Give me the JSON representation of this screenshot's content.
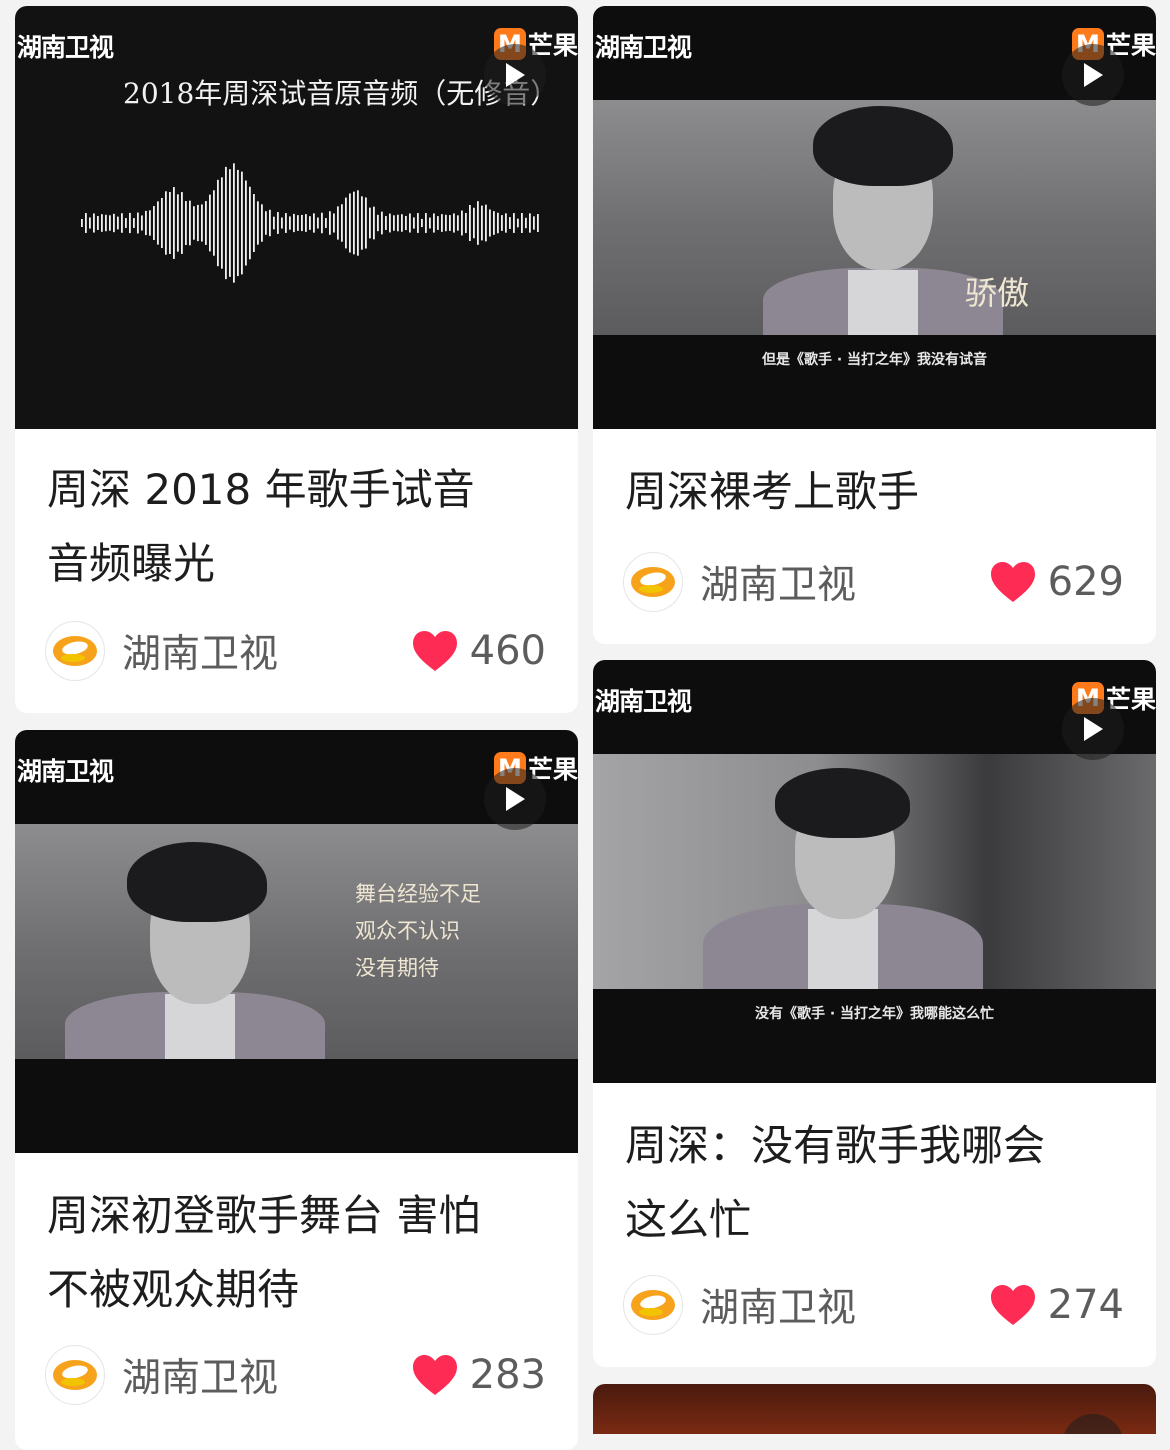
{
  "watermarks": {
    "left": "湖南卫视",
    "right_logo": "M",
    "right_text": "芒果"
  },
  "cards": [
    {
      "title_line1": "周深 2018 年歌手试音",
      "title_line2": "音频曝光",
      "thumb_headline": "2018年周深试音原音频（无修音）",
      "author": "湖南卫视",
      "likes": "460"
    },
    {
      "title_line1": "周深裸考上歌手",
      "thumb_side": "骄傲",
      "thumb_subtitle": "但是《歌手 · 当打之年》我没有试音",
      "author": "湖南卫视",
      "likes": "629"
    },
    {
      "title_line1": "周深初登歌手舞台 害怕",
      "title_line2": "不被观众期待",
      "thumb_side_lines": [
        "舞台经验不足",
        "观众不认识",
        "没有期待"
      ],
      "author": "湖南卫视",
      "likes": "283"
    },
    {
      "title_line1": "周深：没有歌手我哪会",
      "title_line2": "这么忙",
      "thumb_subtitle": "没有《歌手 · 当打之年》我哪能这么忙",
      "author": "湖南卫视",
      "likes": "274"
    }
  ],
  "colors": {
    "heart": "#fe2c55",
    "avatar_orange": "#f7a21b",
    "mango_orange": "#ff7a1a"
  },
  "icons": {
    "play": "play-icon",
    "like": "heart-icon",
    "avatar": "hunan-tv-logo"
  }
}
